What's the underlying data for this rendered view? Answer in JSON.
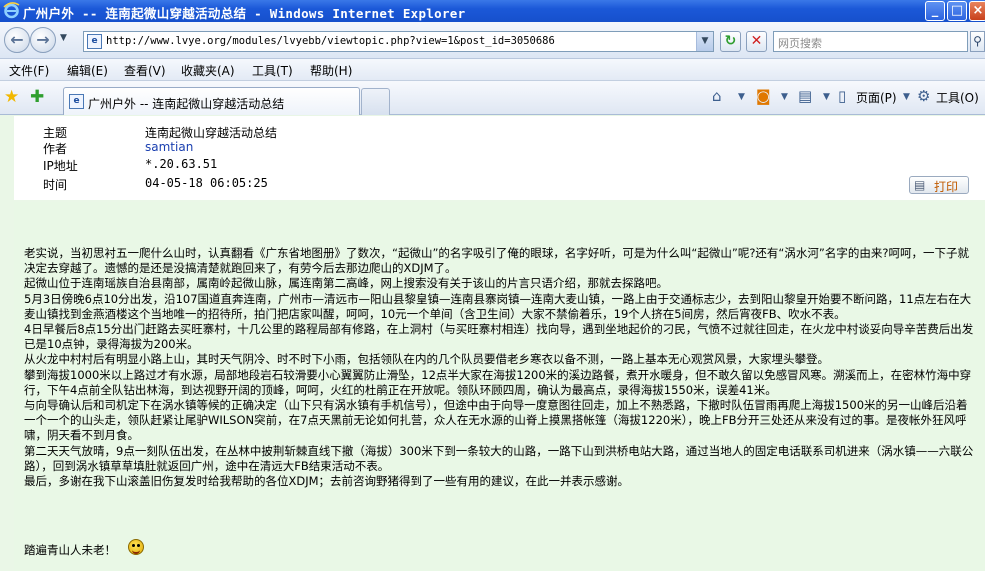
{
  "window": {
    "title": "广州户外 -- 连南起微山穿越活动总结 - Windows Internet Explorer"
  },
  "address": {
    "url": "http://www.lvye.org/modules/lvyebb/viewtopic.php?view=1&post_id=3050686"
  },
  "search": {
    "placeholder": "网页搜索"
  },
  "menu": [
    "文件(F)",
    "编辑(E)",
    "查看(V)",
    "收藏夹(A)",
    "工具(T)",
    "帮助(H)"
  ],
  "tabs": [
    {
      "label": "广州户外 -- 连南起微山穿越活动总结"
    }
  ],
  "commands": {
    "page": "页面(P)",
    "tools": "工具(O)"
  },
  "post": {
    "labels": {
      "subject": "主题",
      "author": "作者",
      "ip": "IP地址",
      "time": "时间"
    },
    "subject": "连南起微山穿越活动总结",
    "author": "samtian",
    "ip": "*.20.63.51",
    "time": "04-05-18 06:05:25",
    "print_label": "打印",
    "body": [
      "老实说，当初思衬五一爬什么山时，认真翻看《广东省地图册》了数次，“起微山”的名字吸引了俺的眼球，名字好听，可是为什么叫“起微山”呢?还有“涡水河”名字的由来?呵呵，一下子就决定去穿越了。遗憾的是还是没搞清楚就跑回来了，有劳今后去那边爬山的XDJM了。",
      "起微山位于连南瑶族自治县南部，属南岭起微山脉，属连南第二高峰，网上搜索没有关于该山的片言只语介绍，那就去探路吧。",
      "5月3日傍晚6点10分出发，沿107国道直奔连南，广州市—清远市—阳山县黎皇镇—连南县寨岗镇—连南大麦山镇，一路上由于交通标志少，去到阳山黎皇开始要不断问路，11点左右在大麦山镇找到金燕酒楼这个当地唯一的招待所，拍门把店家叫醒，呵呵，10元一个单间（含卫生间）大家不禁偷着乐，19个人挤在5间房，然后宵夜FB、吹水不表。",
      "4日早餐后8点15分出门赶路去买旺寨村，十几公里的路程局部有修路，在上洞村（与买旺寨村相连）找向导，遇到坐地起价的刁民，气愤不过就往回走，在火龙中村谈妥向导辛苦费后出发已是10点钟，录得海拔为200米。",
      "从火龙中村村后有明显小路上山，其时天气阴冷、时不时下小雨，包括领队在内的几个队员要借老乡寒衣以备不测，一路上基本无心观赏风景，大家埋头攀登。",
      "攀到海拔1000米以上路过才有水源，局部地段岩石较滑要小心翼翼防止滑坠，12点半大家在海拔1200米的溪边路餐，煮开水暖身，但不敢久留以免感冒风寒。溯溪而上，在密林竹海中穿行，下午4点前全队钻出林海，到达视野开阔的顶峰，呵呵，火红的杜鹃正在开放呢。领队环顾四周，确认为最高点，录得海拔1550米，误差41米。",
      "与向导确认后和司机定下在涡水镇等候的正确决定（山下只有涡水镇有手机信号），但途中由于向导一度意图往回走，加上不熟悉路，下撤时队伍冒雨再爬上海拔1500米的另一山峰后沿着一个一个的山头走，领队赶紧让尾驴WILSON突前，在7点天黑前无论如何扎营，众人在无水源的山脊上摸黑搭帐篷（海拔1220米），晚上FB分开三处还从来没有过的事。是夜帐外狂风呼啸，阴天看不到月食。",
      "第二天天气放晴，9点一刻队伍出发，在丛林中披荆斩棘直线下撤（海拔）300米下到一条较大的山路，一路下山到洪桥电站大路，通过当地人的固定电话联系司机进来（涡水镇——六联公路），回到涡水镇草草填肚就返回广州，途中在清远大FB结束活动不表。",
      "最后，多谢在我下山滚盖旧伤复发时给我帮助的各位XDJM；去前咨询野猪得到了一些有用的建议，在此一并表示感谢。"
    ],
    "signature": "踏遍青山人未老！"
  }
}
